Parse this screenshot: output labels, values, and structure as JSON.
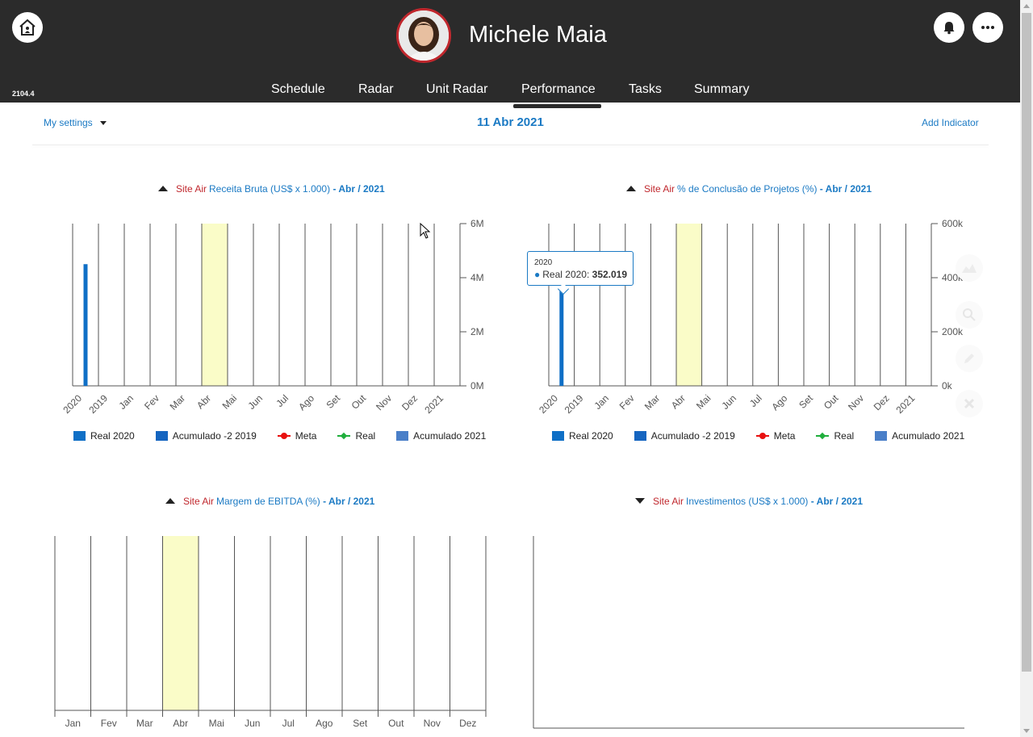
{
  "header": {
    "version": "2104.4",
    "user_name": "Michele Maia",
    "nav": [
      {
        "label": "Schedule"
      },
      {
        "label": "Radar"
      },
      {
        "label": "Unit Radar"
      },
      {
        "label": "Performance",
        "active": true
      },
      {
        "label": "Tasks"
      },
      {
        "label": "Summary"
      }
    ],
    "icons": {
      "home": "home-icon",
      "bell": "bell-icon",
      "more": "more-icon"
    }
  },
  "toolbar": {
    "settings_label": "My settings",
    "date": "11 Abr 2021",
    "add_indicator_label": "Add Indicator"
  },
  "charts": [
    {
      "site": "Site Air",
      "indicator": "Receita Bruta (US$ x 1.000)",
      "period": "- Abr / 2021",
      "trend": "up"
    },
    {
      "site": "Site Air",
      "indicator": "% de Conclusão de Projetos (%)",
      "period": "- Abr / 2021",
      "trend": "up"
    },
    {
      "site": "Site Air",
      "indicator": "Margem de EBITDA (%)",
      "period": "- Abr / 2021",
      "trend": "up"
    },
    {
      "site": "Site Air",
      "indicator": "Investimentos (US$ x 1.000)",
      "period": "- Abr / 2021",
      "trend": "down"
    }
  ],
  "legend": [
    {
      "label": "Real 2020",
      "kind": "square",
      "color": "#0f6fc6"
    },
    {
      "label": "Acumulado -2 2019",
      "kind": "square",
      "color": "#1565c0"
    },
    {
      "label": "Meta",
      "kind": "line-circle",
      "color": "#e8100f"
    },
    {
      "label": "Real",
      "kind": "line-diamond",
      "color": "#1fae3c"
    },
    {
      "label": "Acumulado 2021",
      "kind": "square",
      "color": "#4a7fc8"
    }
  ],
  "tooltip": {
    "date": "2020",
    "series": "Real 2020:",
    "value": "352.019"
  },
  "colors": {
    "header_bg": "#2b2b2b",
    "accent": "#1b7ac4",
    "site_red": "#c0272d",
    "highlight": "#fafcc8"
  },
  "chart_data": [
    {
      "type": "bar",
      "categories": [
        "2020",
        "2019",
        "Jan",
        "Fev",
        "Mar",
        "Abr",
        "Mai",
        "Jun",
        "Jul",
        "Ago",
        "Set",
        "Out",
        "Nov",
        "Dez",
        "2021"
      ],
      "series": [
        {
          "name": "Real 2020",
          "values": [
            4500000,
            null,
            null,
            null,
            null,
            null,
            null,
            null,
            null,
            null,
            null,
            null,
            null,
            null,
            null
          ]
        }
      ],
      "y_ticks": [
        "0M",
        "2M",
        "4M",
        "6M"
      ],
      "ylim": [
        0,
        6000000
      ],
      "highlight_category": "Abr"
    },
    {
      "type": "bar",
      "categories": [
        "2020",
        "2019",
        "Jan",
        "Fev",
        "Mar",
        "Abr",
        "Mai",
        "Jun",
        "Jul",
        "Ago",
        "Set",
        "Out",
        "Nov",
        "Dez",
        "2021"
      ],
      "series": [
        {
          "name": "Real 2020",
          "values": [
            352019,
            null,
            null,
            null,
            null,
            null,
            null,
            null,
            null,
            null,
            null,
            null,
            null,
            null,
            null
          ]
        }
      ],
      "y_ticks": [
        "0k",
        "200k",
        "400k",
        "600k"
      ],
      "ylim": [
        0,
        600000
      ],
      "highlight_category": "Abr"
    },
    {
      "type": "bar",
      "categories": [
        "Jan",
        "Fev",
        "Mar",
        "Abr",
        "Mai",
        "Jun",
        "Jul",
        "Ago",
        "Set",
        "Out",
        "Nov",
        "Dez"
      ],
      "series": [],
      "highlight_category": "Abr"
    },
    {
      "type": "bar",
      "categories": [],
      "series": []
    }
  ]
}
